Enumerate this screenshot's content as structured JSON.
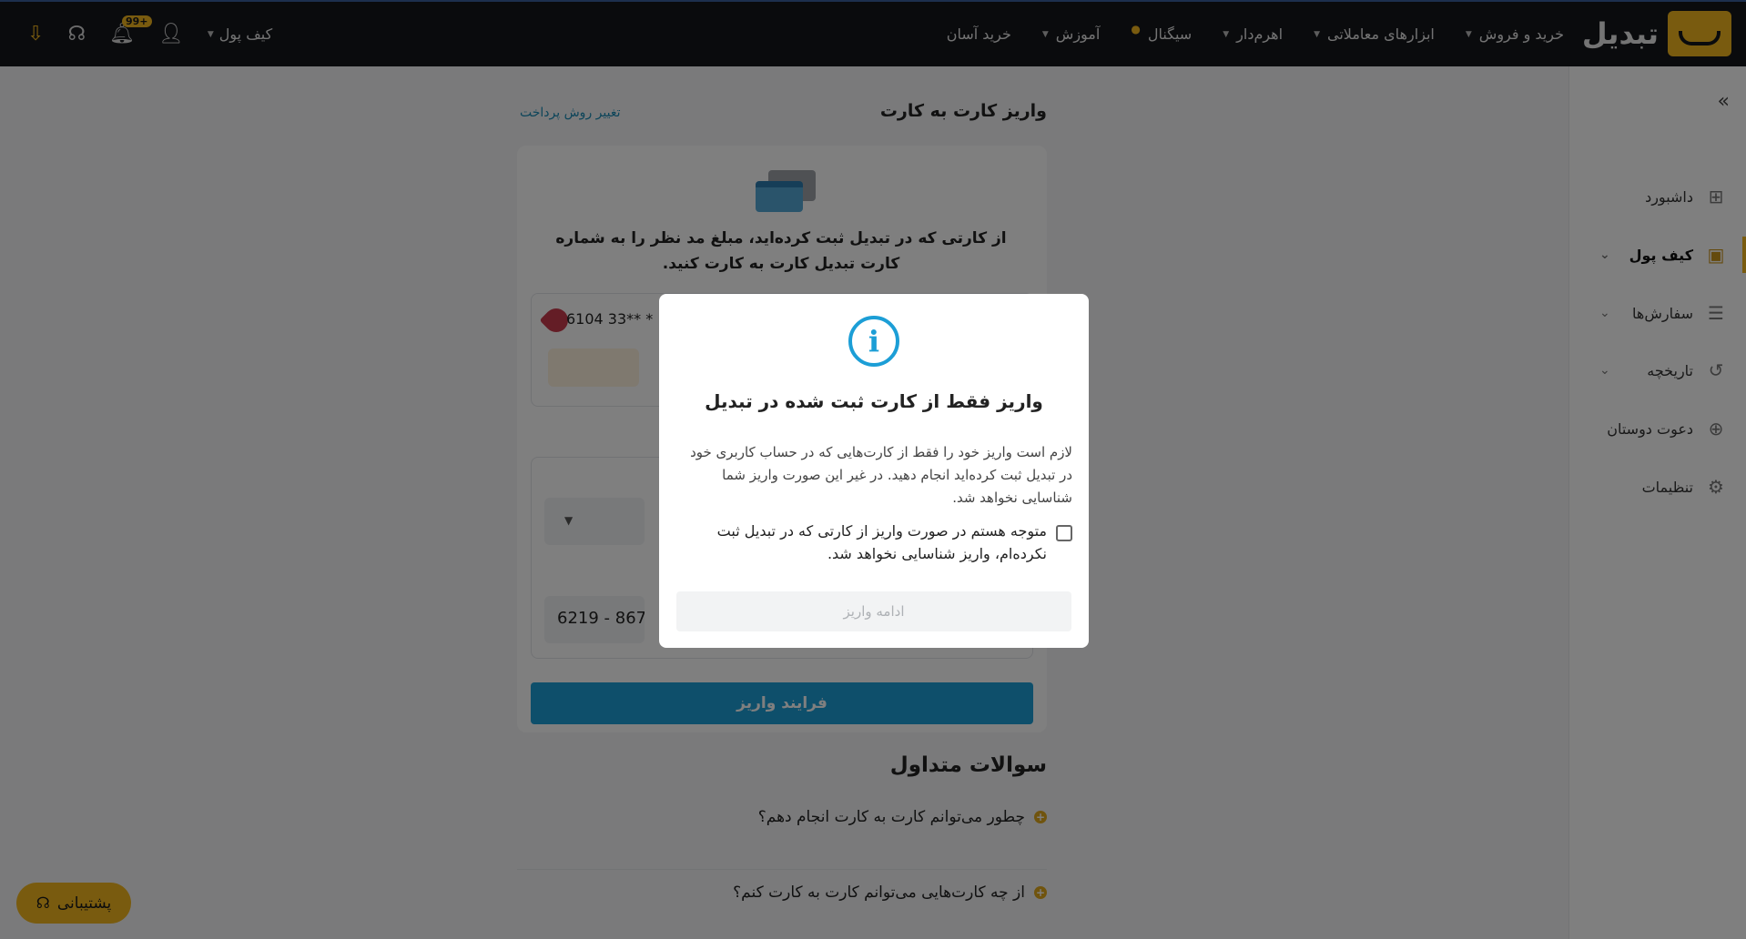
{
  "header": {
    "brand": "تبدیل",
    "nav": [
      {
        "label": "خرید و فروش",
        "caret": true
      },
      {
        "label": "ابزارهای معاملاتی",
        "caret": true
      },
      {
        "label": "اهرم‌دار",
        "caret": true
      },
      {
        "label": "سیگنال",
        "caret": false
      },
      {
        "label": "آموزش",
        "caret": true
      },
      {
        "label": "خرید آسان",
        "caret": false
      }
    ],
    "wallet_menu": "کیف پول",
    "notification_count": "99+"
  },
  "sidebar": {
    "items": [
      {
        "label": "داشبورد",
        "icon": "grid-icon",
        "active": false
      },
      {
        "label": "کیف پول",
        "icon": "wallet-icon",
        "active": true
      },
      {
        "label": "سفارش‌ها",
        "icon": "orders-icon",
        "active": false
      },
      {
        "label": "تاریخچه",
        "icon": "history-icon",
        "active": false
      },
      {
        "label": "دعوت دوستان",
        "icon": "add-user-icon",
        "active": false
      },
      {
        "label": "تنظیمات",
        "icon": "gear-icon",
        "active": false
      }
    ]
  },
  "main": {
    "title": "واریز کارت به کارت",
    "change_method": "تغییر روش پرداخت",
    "description": "از کارتی که در تبدیل ثبت کرده‌اید، مبلغ مد نظر را به شماره کارت تبدیل کارت به کارت کنید.",
    "source_card": "6104 33** *",
    "dest_card": "6219 - 8670 -",
    "submit": "فرایند واریز",
    "faq_title": "سوالات متداول",
    "faq": [
      "چطور می‌توانم کارت به کارت انجام دهم؟",
      "از چه کارت‌هایی می‌توانم کارت به کارت کنم؟"
    ]
  },
  "support": "پشتیبانی",
  "modal": {
    "title": "واریز فقط از کارت ثبت شده در تبدیل",
    "body": "لازم است واریز خود را فقط از کارت‌هایی که در حساب کاربری خود در تبدیل ثبت کرده‌اید انجام دهید. در غیر این صورت واریز شما شناسایی نخواهد شد.",
    "checkbox_label": "متوجه هستم در صورت واریز از کارتی که در تبدیل ثبت نکرده‌ام، واریز شناسایی نخواهد شد.",
    "checked": false,
    "continue": "ادامه واریز"
  },
  "colors": {
    "accent": "#f3b71e",
    "primary": "#1c9ed6",
    "header_bg": "#14161b"
  }
}
